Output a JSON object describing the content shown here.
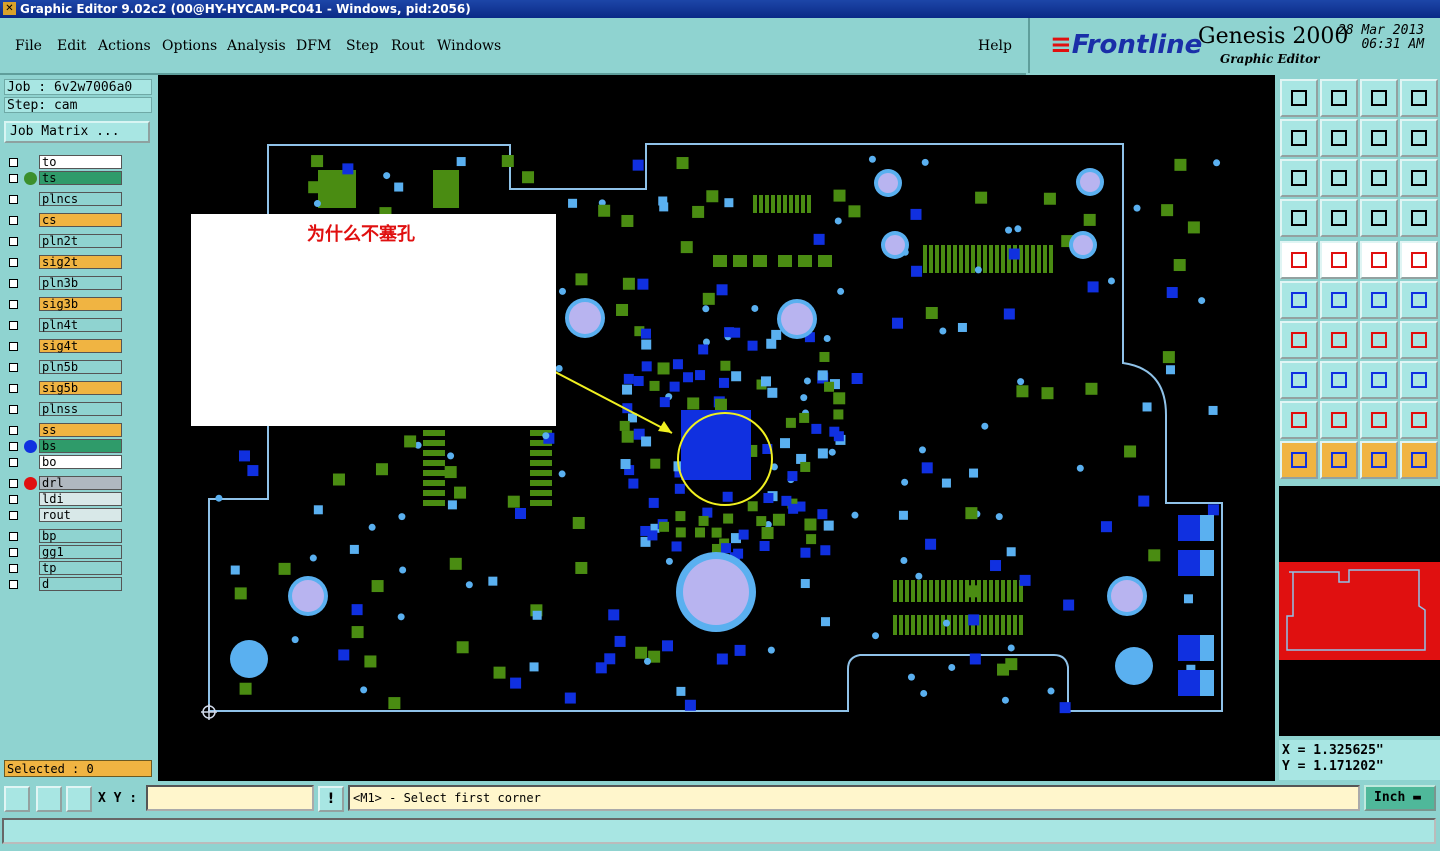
{
  "window": {
    "title": "Graphic Editor 9.02c2 (00@HY-HYCAM-PC041 - Windows, pid:2056)"
  },
  "menu": {
    "items": [
      "File",
      "Edit",
      "Actions",
      "Options",
      "Analysis",
      "DFM",
      "Step",
      "Rout",
      "Windows"
    ],
    "help": "Help"
  },
  "brand": {
    "company": "Frontline",
    "product": "Genesis 2000",
    "subtitle": "Graphic Editor",
    "date": "28 Mar 2013",
    "time": "06:31 AM"
  },
  "job": {
    "job_line": "Job : 6v2w7006a0",
    "step_line": "Step: cam",
    "matrix_button": "Job Matrix ..."
  },
  "layers": [
    {
      "name": "to",
      "color": "#ffffff",
      "dot": ""
    },
    {
      "name": "ts",
      "color": "#2f9b6a",
      "dot": "#3c8f2c"
    },
    {
      "name": "plncs",
      "color": "#8fd3d0",
      "dot": ""
    },
    {
      "name": "cs",
      "color": "#f0b442",
      "dot": ""
    },
    {
      "name": "pln2t",
      "color": "#8fd3d0",
      "dot": ""
    },
    {
      "name": "sig2t",
      "color": "#f0b442",
      "dot": ""
    },
    {
      "name": "pln3b",
      "color": "#8fd3d0",
      "dot": ""
    },
    {
      "name": "sig3b",
      "color": "#f0b442",
      "dot": ""
    },
    {
      "name": "pln4t",
      "color": "#8fd3d0",
      "dot": ""
    },
    {
      "name": "sig4t",
      "color": "#f0b442",
      "dot": ""
    },
    {
      "name": "pln5b",
      "color": "#8fd3d0",
      "dot": ""
    },
    {
      "name": "sig5b",
      "color": "#f0b442",
      "dot": ""
    },
    {
      "name": "plnss",
      "color": "#8fd3d0",
      "dot": ""
    },
    {
      "name": "ss",
      "color": "#f0b442",
      "dot": ""
    },
    {
      "name": "bs",
      "color": "#2f9b6a",
      "dot": "#1030e0"
    },
    {
      "name": "bo",
      "color": "#ffffff",
      "dot": ""
    },
    {
      "name": "drl",
      "color": "#b0b8c0",
      "dot": "#e01010"
    },
    {
      "name": "ldi",
      "color": "#d8e8e8",
      "dot": ""
    },
    {
      "name": "rout",
      "color": "#d8e8e8",
      "dot": ""
    },
    {
      "name": "bp",
      "color": "#8fd3d0",
      "dot": ""
    },
    {
      "name": "gg1",
      "color": "#8fd3d0",
      "dot": ""
    },
    {
      "name": "tp",
      "color": "#8fd3d0",
      "dot": ""
    },
    {
      "name": "d",
      "color": "#8fd3d0",
      "dot": ""
    }
  ],
  "selected": "Selected : 0",
  "annotation": {
    "text": "为什么不塞孔"
  },
  "coords": {
    "x": "X = 1.325625\"",
    "y": "Y = 1.171202\""
  },
  "status": {
    "xy_label": "X Y :",
    "xy_value": "",
    "message": "<M1> - Select first corner",
    "unit": "Inch"
  },
  "colors": {
    "board_green": "#4a8c12",
    "pad_blue": "#1030e0",
    "via_light": "#b8b4f0",
    "via_blue": "#5ab0f0",
    "outline": "#8fc2e8"
  }
}
